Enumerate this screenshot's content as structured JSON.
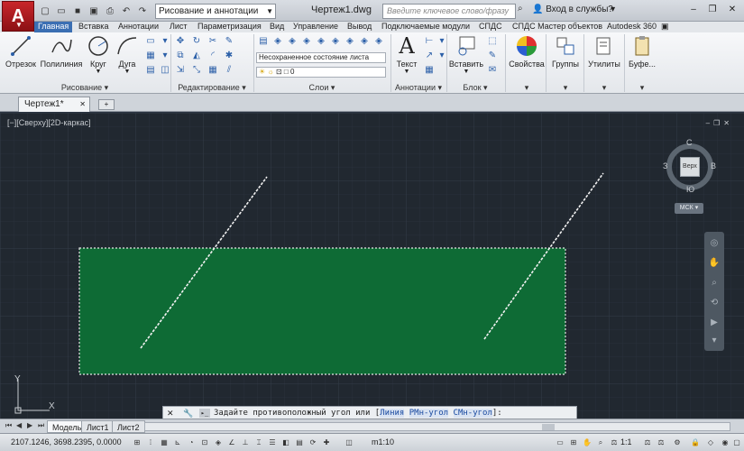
{
  "titlebar": {
    "workspace": "Рисование и аннотации",
    "title": "Чертеж1.dwg",
    "search_placeholder": "Введите ключевое слово/фразу",
    "login": "Вход в службы"
  },
  "ribbon_tabs": [
    "Главная",
    "Вставка",
    "Аннотации",
    "Лист",
    "Параметризация",
    "Вид",
    "Управление",
    "Вывод",
    "Подключаемые модули",
    "СПДС",
    "СПДС Мастер объектов",
    "Autodesk 360"
  ],
  "ribbon": {
    "draw_tools": [
      "Отрезок",
      "Полилиния",
      "Круг",
      "Дуга"
    ],
    "panel_draw": "Рисование",
    "panel_modify": "Редактирование",
    "layer_state": "Несохраненное состояние листа",
    "layer_current": "0",
    "panel_layers": "Слои",
    "text_tool": "Текст",
    "panel_annotations": "Аннотации",
    "insert_tool": "Вставить",
    "panel_block": "Блок",
    "properties_tool": "Свойства",
    "groups_tool": "Группы",
    "utilities_tool": "Утилиты",
    "clipboard_tool": "Буфе..."
  },
  "doc_tab": "Чертеж1*",
  "viewport_label": "[−][Сверху][2D-каркас]",
  "viewcube": {
    "face": "Верх",
    "n": "С",
    "s": "Ю",
    "w": "З",
    "e": "В",
    "wcs": "МСК"
  },
  "ucs": {
    "x": "X",
    "y": "Y"
  },
  "command": {
    "prompt": "Задайте противоположный угол или [",
    "opt1": "Линия",
    "sep1": " ",
    "opt2": "РМн-угол",
    "sep2": " ",
    "opt3": "СМн-угол",
    "end": "]:"
  },
  "layout_tabs": [
    "Модель",
    "Лист1",
    "Лист2"
  ],
  "status": {
    "coords": "2107.1246, 3698.2395, 0.0000",
    "scale": "m1:10",
    "annoscale": "1:1"
  },
  "colors": {
    "selection_fill": "#0e6b35",
    "canvas": "#212830",
    "accent": "#3b6fb3"
  }
}
